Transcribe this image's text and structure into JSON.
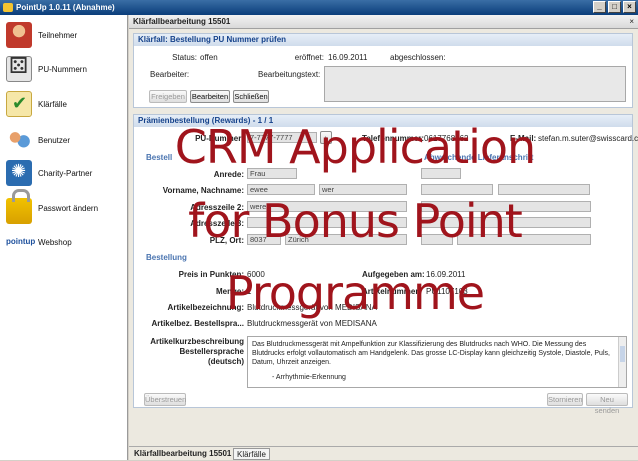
{
  "window": {
    "title": "PointUp 1.0.11 (Abnahme)",
    "minimize": "_",
    "maximize": "□",
    "close": "×"
  },
  "sidebar": {
    "items": [
      {
        "label": "Teilnehmer"
      },
      {
        "label": "PU-Nummern"
      },
      {
        "label": "Klärfälle"
      },
      {
        "label": "Benutzer"
      },
      {
        "label": "Charity-Partner"
      },
      {
        "label": "Passwort ändern"
      },
      {
        "label": "Webshop",
        "logo_text": "pointup"
      }
    ]
  },
  "main": {
    "title": "Klärfallbearbeitung 15501",
    "close": "×",
    "case_panel": {
      "title": "Klärfall: Bestellung PU Nummer prüfen",
      "status_label": "Status:",
      "status_value": "offen",
      "opened_label": "eröffnet:",
      "opened_value": "16.09.2011",
      "closed_label": "abgeschlossen:",
      "editor_label": "Bearbeiter:",
      "editing_text_label": "Bearbeitungstext:",
      "buttons": {
        "release": "Freigeben",
        "edit": "Bearbeiten",
        "close": "Schließen"
      }
    },
    "order_panel": {
      "title": "Prämienbestellung (Rewards) - 1 / 1",
      "pu_label": "PU-Nummer:",
      "pu_value": "7-7777-7777",
      "phone_label": "Telefonnummer:",
      "phone_value": "0617768762",
      "email_label": "E-Mail:",
      "email_value": "stefan.m.suter@swisscard.ch",
      "section_left": "Bestell",
      "section_right": "Abweichende Lieferanschrift",
      "salutation_label": "Anrede:",
      "salutation_value": "Frau",
      "name_label": "Vorname, Nachname:",
      "first_name": "ewee",
      "last_name": "wer",
      "address2_label": "Adresszeile 2:",
      "address2_value": "werer",
      "address3_label": "Adresszeile 3:",
      "zip_city_label": "PLZ, Ort:",
      "zip_value": "8037",
      "city_value": "Zürich",
      "order_section": "Bestellung",
      "points_label": "Preis in Punkten:",
      "points_value": "6000",
      "ordered_label": "Aufgegeben am:",
      "ordered_value": "16.09.2011",
      "qty_label": "Menge:",
      "qty_value": "1",
      "article_no_label": "Artikelnummer:",
      "article_no_value": "PU1107103",
      "article_desc_label": "Artikelbezeichnung:",
      "article_desc_value": "Blutdruckmessgerät von MEDISANA",
      "article_desc_lang_label": "Artikelbez. Bestellspra...",
      "article_desc_lang_value": "Blutdruckmessgerät von MEDISANA",
      "article_long_label_1": "Artikelkurzbeschreibung",
      "article_long_label_2": "Bestellersprache",
      "article_long_label_3": "(deutsch)",
      "article_long_text": "Das Blutdruckmessgerät mit Ampelfunktion zur Klassifizierung des Blutdrucks nach WHO. Die Messung des Blutdrucks erfolgt vollautomatisch am Handgelenk. Das grosse LC-Display kann gleichzeitig Systole, Diastole, Puls, Datum, Uhrzeit anzeigen.",
      "article_long_text_2": "- Arrhythmie-Erkennung",
      "buttons": {
        "override": "Überstreuen",
        "cancel": "Stornieren",
        "resend": "Neu senden"
      }
    },
    "status_tabs": [
      "Klärfallbearbeitung 15501",
      "Klärfälle"
    ]
  },
  "overlay": {
    "line1": "CRM Application",
    "line2": "for Bonus Point",
    "line3": "Programme"
  },
  "colors": {
    "overlay": "#a0141c",
    "section": "#4a74b0",
    "title_bar": "#0a3d7a"
  }
}
